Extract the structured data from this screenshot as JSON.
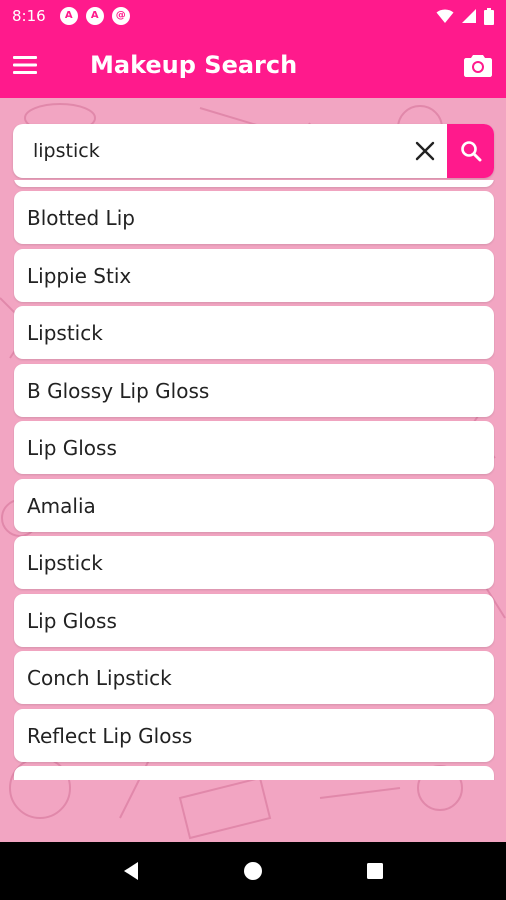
{
  "status_bar": {
    "time": "8:16",
    "notification_icons": [
      "A",
      "A",
      "@"
    ]
  },
  "app_bar": {
    "title": "Makeup Search",
    "menu_icon": "hamburger-menu-icon",
    "camera_icon": "camera-icon"
  },
  "search": {
    "value": "lipstick",
    "placeholder": "",
    "clear_icon": "close-icon",
    "search_icon": "search-icon"
  },
  "results": [
    "",
    "Blotted Lip",
    "Lippie Stix",
    "Lipstick",
    "B Glossy Lip Gloss",
    "Lip Gloss",
    "Amalia",
    "Lipstick",
    "Lip Gloss",
    "Conch Lipstick",
    "Reflect Lip Gloss",
    ""
  ],
  "colors": {
    "accent": "#ff1a8c",
    "background": "#f2a5c2"
  }
}
